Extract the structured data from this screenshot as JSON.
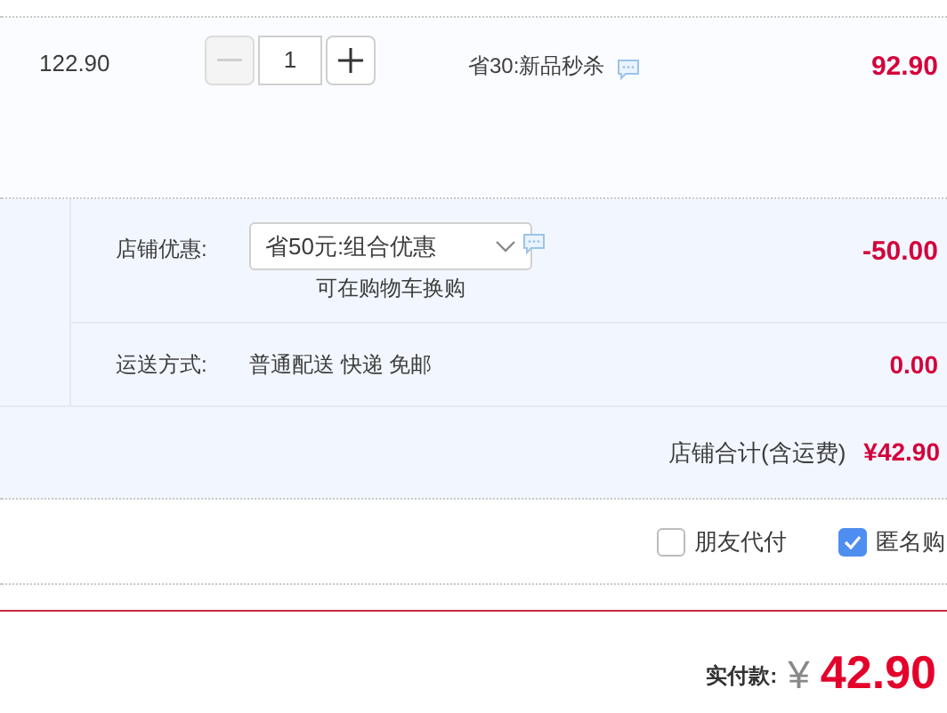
{
  "item": {
    "unit_price": "122.90",
    "quantity": "1",
    "decrement_disabled": true,
    "promotion": "省30:新品秒杀",
    "subtotal": "92.90"
  },
  "shop_discount": {
    "label": "店铺优惠:",
    "selection": "省50元:组合优惠",
    "hint": "可在购物车换购",
    "amount": "-50.00"
  },
  "shipping": {
    "label": "运送方式:",
    "method": "普通配送 快递 免邮",
    "amount": "0.00"
  },
  "shop_total": {
    "label": "店铺合计(含运费)",
    "amount": "¥42.90"
  },
  "options": [
    {
      "label": "朋友代付",
      "checked": false
    },
    {
      "label": "匿名购",
      "checked": true
    }
  ],
  "payment": {
    "label": "实付款:",
    "currency": "¥",
    "amount": "42.90"
  }
}
